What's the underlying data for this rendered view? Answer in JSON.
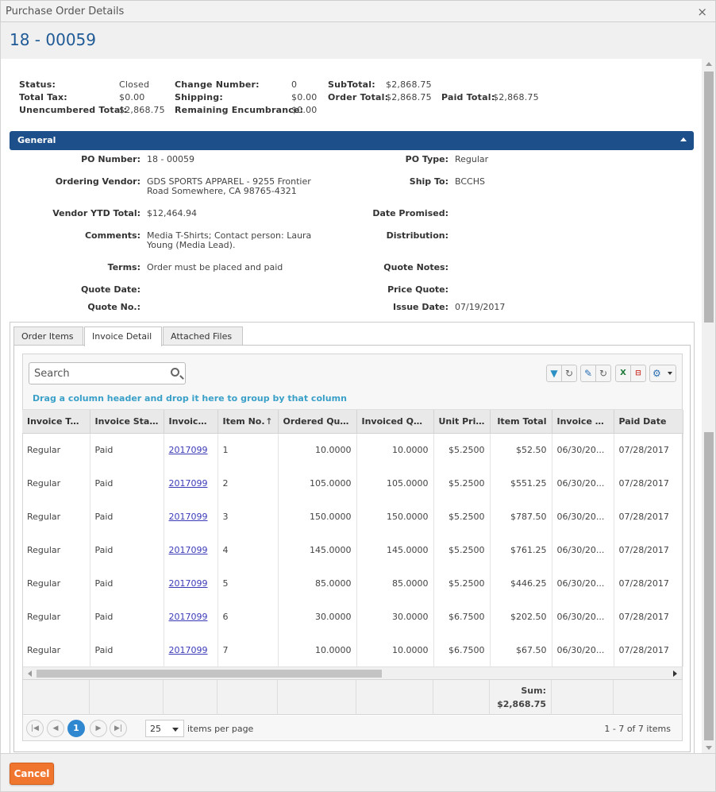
{
  "window": {
    "title": "Purchase Order Details",
    "close_glyph": "×"
  },
  "header": {
    "po_number": "18 - 00059"
  },
  "summary": {
    "status_label": "Status:",
    "status_value": "Closed",
    "change_number_label": "Change Number:",
    "change_number_value": "0",
    "subtotal_label": "SubTotal:",
    "subtotal_value": "$2,868.75",
    "total_tax_label": "Total Tax:",
    "total_tax_value": "$0.00",
    "shipping_label": "Shipping:",
    "shipping_value": "$0.00",
    "order_total_label": "Order Total:",
    "order_total_value": "$2,868.75",
    "paid_total_label": "Paid Total:",
    "paid_total_value": "$2,868.75",
    "unencumbered_label": "Unencumbered Total:",
    "unencumbered_value": "$2,868.75",
    "remaining_label": "Remaining Encumbrance:",
    "remaining_value": "$0.00"
  },
  "general": {
    "title": "General",
    "po_number_label": "PO Number:",
    "po_number_value": "18 - 00059",
    "po_type_label": "PO Type:",
    "po_type_value": "Regular",
    "vendor_label": "Ordering Vendor:",
    "vendor_value_1": "GDS SPORTS APPAREL - 9255 Frontier",
    "vendor_value_2": "Road Somewhere, CA 98765-4321",
    "ship_to_label": "Ship To:",
    "ship_to_value": "BCCHS",
    "ytd_label": "Vendor YTD Total:",
    "ytd_value": "$12,464.94",
    "date_promised_label": "Date Promised:",
    "comments_label": "Comments:",
    "comments_value_1": "Media T-Shirts; Contact person: Laura",
    "comments_value_2": "Young (Media Lead).",
    "distribution_label": "Distribution:",
    "terms_label": "Terms:",
    "terms_value": "Order must be placed and paid",
    "quote_notes_label": "Quote Notes:",
    "quote_date_label": "Quote Date:",
    "price_quote_label": "Price Quote:",
    "quote_no_label": "Quote No.:",
    "issue_date_label": "Issue Date:",
    "issue_date_value": "07/19/2017"
  },
  "tabs": [
    {
      "label": "Order Items"
    },
    {
      "label": "Invoice Detail"
    },
    {
      "label": "Attached Files"
    }
  ],
  "grid": {
    "search_placeholder": "Search",
    "group_hint": "Drag a column header and drop it here to group by that column",
    "sort_glyph": "↑",
    "columns": [
      "Invoice Type",
      "Invoice Status",
      "Invoice(s)",
      "Item No.",
      "Ordered Quantity",
      "Invoiced Quantity",
      "Unit Price",
      "Item Total",
      "Invoice Date",
      "Paid Date"
    ],
    "columns_display": [
      "Invoice Type",
      "Invoice Status",
      "Invoice(s)",
      "Item No.",
      "Ordered Qua...",
      "Invoiced Qu...",
      "Unit Price",
      "Item Total",
      "Invoice D...",
      "Paid Date"
    ],
    "rows": [
      [
        "Regular",
        "Paid",
        "2017099",
        "1",
        "10.0000",
        "10.0000",
        "$5.2500",
        "$52.50",
        "06/30/20...",
        "07/28/2017"
      ],
      [
        "Regular",
        "Paid",
        "2017099",
        "2",
        "105.0000",
        "105.0000",
        "$5.2500",
        "$551.25",
        "06/30/20...",
        "07/28/2017"
      ],
      [
        "Regular",
        "Paid",
        "2017099",
        "3",
        "150.0000",
        "150.0000",
        "$5.2500",
        "$787.50",
        "06/30/20...",
        "07/28/2017"
      ],
      [
        "Regular",
        "Paid",
        "2017099",
        "4",
        "145.0000",
        "145.0000",
        "$5.2500",
        "$761.25",
        "06/30/20...",
        "07/28/2017"
      ],
      [
        "Regular",
        "Paid",
        "2017099",
        "5",
        "85.0000",
        "85.0000",
        "$5.2500",
        "$446.25",
        "06/30/20...",
        "07/28/2017"
      ],
      [
        "Regular",
        "Paid",
        "2017099",
        "6",
        "30.0000",
        "30.0000",
        "$6.7500",
        "$202.50",
        "06/30/20...",
        "07/28/2017"
      ],
      [
        "Regular",
        "Paid",
        "2017099",
        "7",
        "10.0000",
        "10.0000",
        "$6.7500",
        "$67.50",
        "06/30/20...",
        "07/28/2017"
      ]
    ],
    "sum_label": "Sum:",
    "sum_value": "$2,868.75",
    "tool_icons": [
      "filter-icon",
      "refresh-icon",
      "wrench-icon",
      "refresh-icon",
      "excel-icon",
      "pdf-icon",
      "gear-icon"
    ]
  },
  "pager": {
    "current_page": "1",
    "page_size": "25",
    "items_per_page_label": "items per page",
    "range_text": "1 - 7 of 7 items"
  },
  "footer": {
    "cancel_label": "Cancel"
  },
  "colors": {
    "accent": "#1d4f8a",
    "title_blue": "#1f5a96",
    "cancel": "#f0752e",
    "link": "#3b3bb8",
    "hint": "#3aa0c8"
  }
}
